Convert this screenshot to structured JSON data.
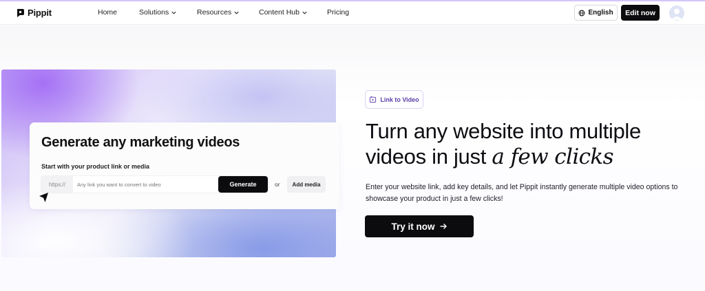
{
  "nav": {
    "brand": "Pippit",
    "links": [
      "Home",
      "Solutions",
      "Resources",
      "Content Hub",
      "Pricing"
    ],
    "language": "English",
    "edit_button": "Edit now"
  },
  "hero_card": {
    "title": "Generate any marketing videos",
    "subtitle": "Start with your product link or media",
    "url_prefix": "https://",
    "url_placeholder": "Any link you want to convert to video",
    "generate_button": "Generate",
    "or": "or",
    "add_media_button": "Add media"
  },
  "hero": {
    "badge": "Link to Video",
    "headline_line1": "Turn any website into multiple",
    "headline_line2": "videos in just ",
    "headline_accent": "a few clicks",
    "description": "Enter your website link, add key details, and let Pippit instantly generate multiple video options to showcase your product in just a few clicks!",
    "cta": "Try it now"
  },
  "colors": {
    "accent": "#5b3fa8",
    "button_dark": "#0c0c0f"
  }
}
